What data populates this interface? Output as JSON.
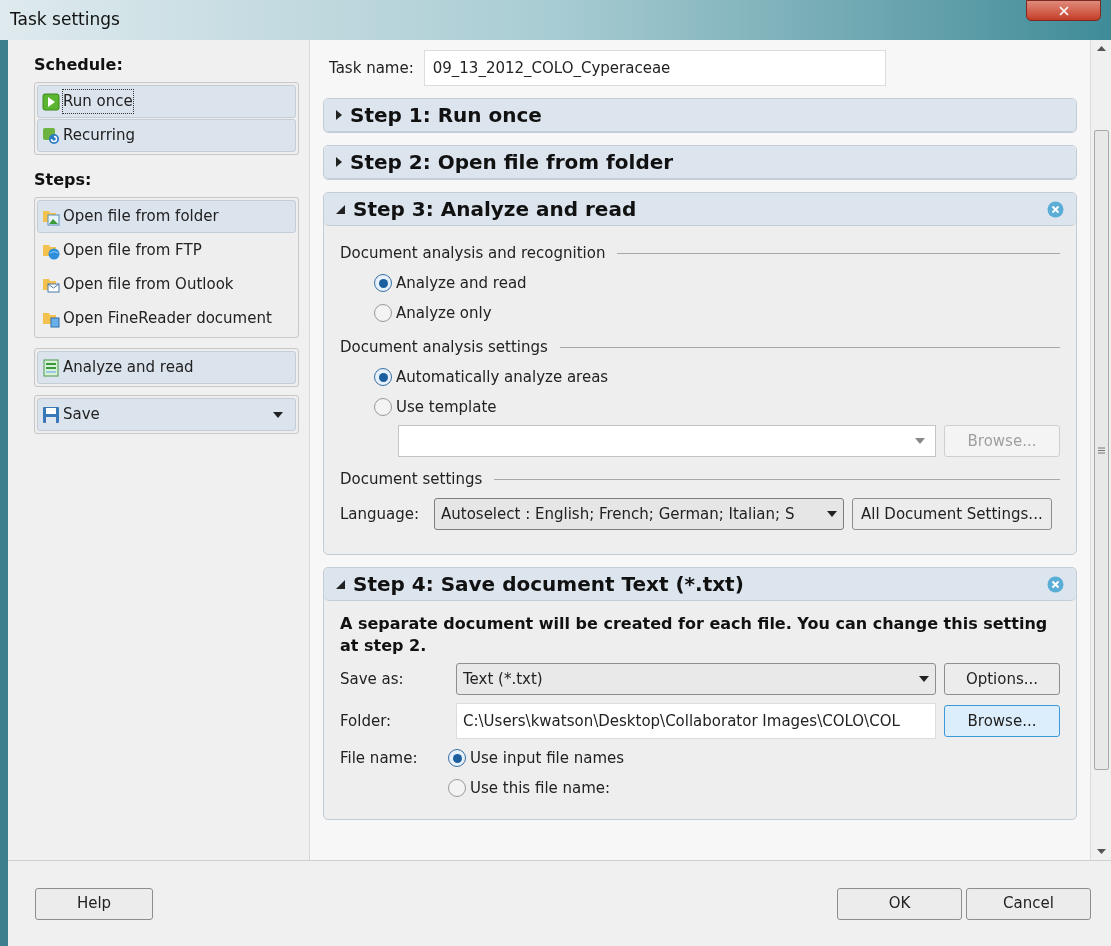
{
  "window": {
    "title": "Task settings"
  },
  "sidebar": {
    "groups": [
      {
        "heading": "Schedule:",
        "kind": "schedule",
        "items": [
          {
            "label": "Run once",
            "kind": "play",
            "selected": true
          },
          {
            "label": "Recurring",
            "kind": "recurring",
            "selected": false
          }
        ]
      },
      {
        "heading": "Steps:",
        "kind": "steps",
        "items": [
          {
            "label": "Open file from folder",
            "kind": "folder",
            "selected": true
          },
          {
            "label": "Open file from FTP",
            "kind": "ftp",
            "selected": false
          },
          {
            "label": "Open file from Outlook",
            "kind": "outlook",
            "selected": false
          },
          {
            "label": "Open FineReader document",
            "kind": "document",
            "selected": false
          }
        ]
      }
    ],
    "actions": [
      {
        "label": "Analyze and read",
        "kind": "analyze",
        "dropdown": false
      },
      {
        "label": "Save",
        "kind": "save",
        "dropdown": true
      }
    ]
  },
  "task_name": {
    "label": "Task name:",
    "value": "09_13_2012_COLO_Cyperaceae"
  },
  "steps": [
    {
      "title": "Step 1: Run once",
      "expanded": false,
      "removable": false
    },
    {
      "title": "Step 2: Open file from folder",
      "expanded": false,
      "removable": false
    },
    {
      "title": "Step 3: Analyze and read",
      "expanded": true,
      "removable": true,
      "sections": [
        {
          "heading": "Document analysis and recognition",
          "rows": [
            {
              "kind": "radio",
              "label": "Analyze and read",
              "selected": true
            },
            {
              "kind": "radio",
              "label": "Analyze only",
              "selected": false
            }
          ]
        },
        {
          "heading": "Document analysis settings",
          "rows": [
            {
              "kind": "radio",
              "label": "Automatically analyze areas",
              "selected": true
            },
            {
              "kind": "radio",
              "label": "Use template",
              "selected": false
            },
            {
              "kind": "combo",
              "button": {
                "label": "Browse...",
                "disabled": true,
                "focused": false
              }
            }
          ]
        },
        {
          "heading": "Document settings",
          "rows": [
            {
              "kind": "select",
              "label": "Language:",
              "value": "Autoselect : English; French; German; Italian; S",
              "button": {
                "label": "All Document Settings...",
                "disabled": false,
                "focused": false
              }
            }
          ]
        }
      ]
    },
    {
      "title": "Step 4: Save document Text (*.txt)",
      "expanded": true,
      "removable": true,
      "note": "A separate document will be created for each file. You can change this setting at step 2.",
      "rows": [
        {
          "kind": "select",
          "label": "Save as:",
          "value": "Text (*.txt)",
          "button": {
            "label": "Options...",
            "disabled": false,
            "focused": false
          }
        },
        {
          "kind": "field",
          "label": "Folder:",
          "value": "C:\\Users\\kwatson\\Desktop\\Collaborator Images\\COLO\\COL",
          "button": {
            "label": "Browse...",
            "disabled": false,
            "focused": true
          }
        },
        {
          "kind": "radios",
          "label": "File name:",
          "options": [
            {
              "label": "Use input file names",
              "selected": true
            },
            {
              "label": "Use this file name:",
              "selected": false
            }
          ]
        }
      ]
    }
  ],
  "footer": {
    "help": "Help",
    "buttons": [
      "OK",
      "Cancel"
    ]
  }
}
